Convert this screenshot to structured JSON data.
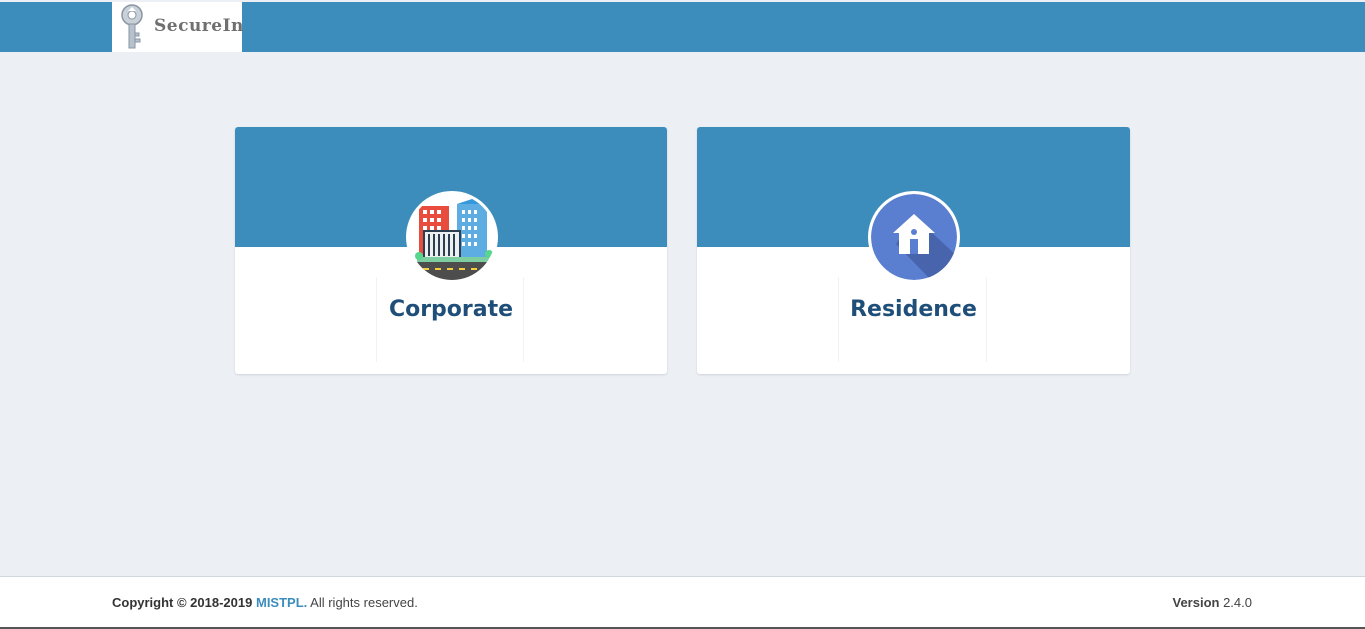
{
  "header": {
    "brand_name": "SecureIn",
    "logo_icon": "key-icon",
    "background_color": "#3c8dbc"
  },
  "cards": [
    {
      "label": "Corporate",
      "icon": "office-buildings-icon"
    },
    {
      "label": "Residence",
      "icon": "house-icon"
    }
  ],
  "footer": {
    "copyright_prefix": "Copyright © 2018-2019",
    "company": "MISTPL.",
    "rights": "All rights reserved.",
    "version_label": "Version",
    "version_value": "2.4.0"
  },
  "colors": {
    "accent": "#3c8dbc",
    "background": "#ecf0f5",
    "card_label": "#1f4e79",
    "house_circle": "#5b7fd0"
  }
}
